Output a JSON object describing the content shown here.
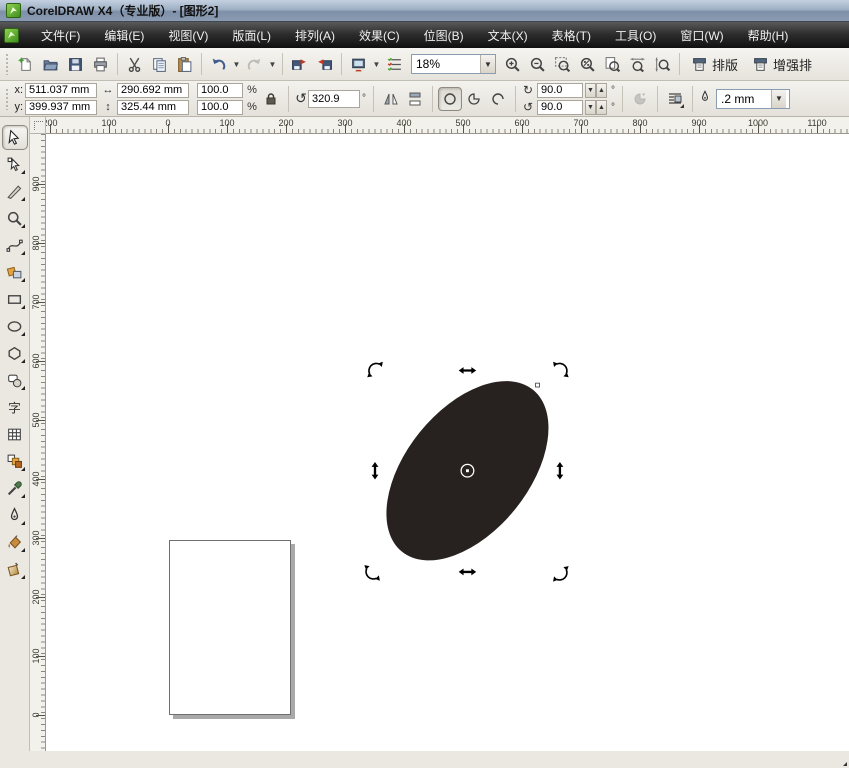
{
  "titlebar": {
    "title": "CorelDRAW X4（专业版）- [图形2]"
  },
  "menubar": {
    "items": [
      {
        "name": "menu-file",
        "label": "文件(F)"
      },
      {
        "name": "menu-edit",
        "label": "编辑(E)"
      },
      {
        "name": "menu-view",
        "label": "视图(V)"
      },
      {
        "name": "menu-layout",
        "label": "版面(L)"
      },
      {
        "name": "menu-arrange",
        "label": "排列(A)"
      },
      {
        "name": "menu-effects",
        "label": "效果(C)"
      },
      {
        "name": "menu-bitmaps",
        "label": "位图(B)"
      },
      {
        "name": "menu-text",
        "label": "文本(X)"
      },
      {
        "name": "menu-table",
        "label": "表格(T)"
      },
      {
        "name": "menu-tools",
        "label": "工具(O)"
      },
      {
        "name": "menu-window",
        "label": "窗口(W)"
      },
      {
        "name": "menu-help",
        "label": "帮助(H)"
      }
    ]
  },
  "toolbar": {
    "zoom_level": "18%",
    "items": [
      {
        "type": "button",
        "name": "new-document-button",
        "icon": "new-document-icon"
      },
      {
        "type": "button",
        "name": "open-button",
        "icon": "open-icon"
      },
      {
        "type": "button",
        "name": "save-button",
        "icon": "save-icon"
      },
      {
        "type": "button",
        "name": "print-button",
        "icon": "print-icon"
      },
      {
        "type": "sep"
      },
      {
        "type": "button",
        "name": "cut-button",
        "icon": "cut-icon"
      },
      {
        "type": "button",
        "name": "copy-button",
        "icon": "copy-icon"
      },
      {
        "type": "button",
        "name": "paste-button",
        "icon": "paste-icon"
      },
      {
        "type": "sep"
      },
      {
        "type": "button",
        "name": "undo-button",
        "icon": "undo-icon",
        "caret": true
      },
      {
        "type": "button",
        "name": "redo-button",
        "icon": "redo-icon",
        "caret": true,
        "disabled": true
      },
      {
        "type": "sep"
      },
      {
        "type": "button",
        "name": "import-button",
        "icon": "import-icon"
      },
      {
        "type": "button",
        "name": "export-button",
        "icon": "export-icon"
      },
      {
        "type": "sep"
      },
      {
        "type": "button",
        "name": "app-launcher-button",
        "icon": "app-launcher-icon",
        "caret": true
      },
      {
        "type": "button",
        "name": "welcome-screen-button",
        "icon": "welcome-screen-icon"
      },
      {
        "type": "zoom-combo"
      },
      {
        "type": "button",
        "name": "zoom-in-button",
        "icon": "zoom-in-icon"
      },
      {
        "type": "button",
        "name": "zoom-out-button",
        "icon": "zoom-out-icon"
      },
      {
        "type": "button",
        "name": "zoom-selected-button",
        "icon": "zoom-selected-icon"
      },
      {
        "type": "button",
        "name": "zoom-all-objects-button",
        "icon": "zoom-all-icon"
      },
      {
        "type": "button",
        "name": "zoom-page-button",
        "icon": "zoom-page-icon"
      },
      {
        "type": "button",
        "name": "zoom-page-width-button",
        "icon": "zoom-width-icon"
      },
      {
        "type": "button",
        "name": "zoom-page-height-button",
        "icon": "zoom-height-icon"
      },
      {
        "type": "sep"
      },
      {
        "type": "labelbtn",
        "name": "layout-workspace-button",
        "icon": "workspace-icon",
        "label": "排版",
        "flyout": true
      },
      {
        "type": "labelbtn",
        "name": "enhanced-workspace-button",
        "icon": "workspace-icon",
        "label": "增强排"
      }
    ]
  },
  "property_bar": {
    "x_label": "x:",
    "x_value": "511.037 mm",
    "y_label": "y:",
    "y_value": "399.937 mm",
    "width_value": "290.692 mm",
    "height_value": "325.44 mm",
    "scale_h_value": "100.0",
    "scale_v_value": "100.0",
    "percent": "%",
    "rotation_value": "320.9",
    "degree": "°",
    "start_angle_value": "90.0",
    "end_angle_value": "90.0",
    "outline_width_value": ".2 mm"
  },
  "rulers": {
    "horizontal_labels": [
      "200",
      "100",
      "0",
      "100",
      "200",
      "300",
      "400",
      "500",
      "600",
      "700",
      "800",
      "900",
      "1000",
      "1100"
    ],
    "vertical_labels": [
      "900",
      "800",
      "700",
      "600",
      "500",
      "400",
      "300",
      "200",
      "100",
      "0"
    ]
  },
  "toolbox": {
    "tools": [
      {
        "name": "pick-tool",
        "icon": "pick-tool-icon",
        "selected": true
      },
      {
        "name": "shape-tool",
        "icon": "shape-tool-icon",
        "flyout": true
      },
      {
        "name": "crop-tool",
        "icon": "crop-tool-icon",
        "flyout": true
      },
      {
        "name": "zoom-tool",
        "icon": "zoom-tool-icon",
        "flyout": true
      },
      {
        "name": "freehand-tool",
        "icon": "freehand-tool-icon",
        "flyout": true
      },
      {
        "name": "smart-fill-tool",
        "icon": "smart-fill-tool-icon",
        "flyout": true
      },
      {
        "name": "rectangle-tool",
        "icon": "rectangle-tool-icon",
        "flyout": true
      },
      {
        "name": "ellipse-tool",
        "icon": "ellipse-tool-icon",
        "flyout": true
      },
      {
        "name": "polygon-tool",
        "icon": "polygon-tool-icon",
        "flyout": true
      },
      {
        "name": "basic-shapes-tool",
        "icon": "basic-shapes-tool-icon",
        "flyout": true
      },
      {
        "name": "text-tool",
        "icon": "text-tool-icon"
      },
      {
        "name": "table-tool",
        "icon": "table-tool-icon"
      },
      {
        "name": "blend-tool",
        "icon": "blend-tool-icon",
        "flyout": true
      },
      {
        "name": "eyedropper-tool",
        "icon": "eyedropper-tool-icon",
        "flyout": true
      },
      {
        "name": "outline-tool",
        "icon": "outline-tool-icon",
        "flyout": true
      },
      {
        "name": "fill-tool",
        "icon": "fill-tool-icon",
        "flyout": true
      },
      {
        "name": "interactive-fill-tool",
        "icon": "interactive-fill-tool-icon",
        "flyout": true
      }
    ]
  },
  "canvas": {
    "ellipse_fill": "#272220",
    "selection_mode": "rotate-skew"
  }
}
